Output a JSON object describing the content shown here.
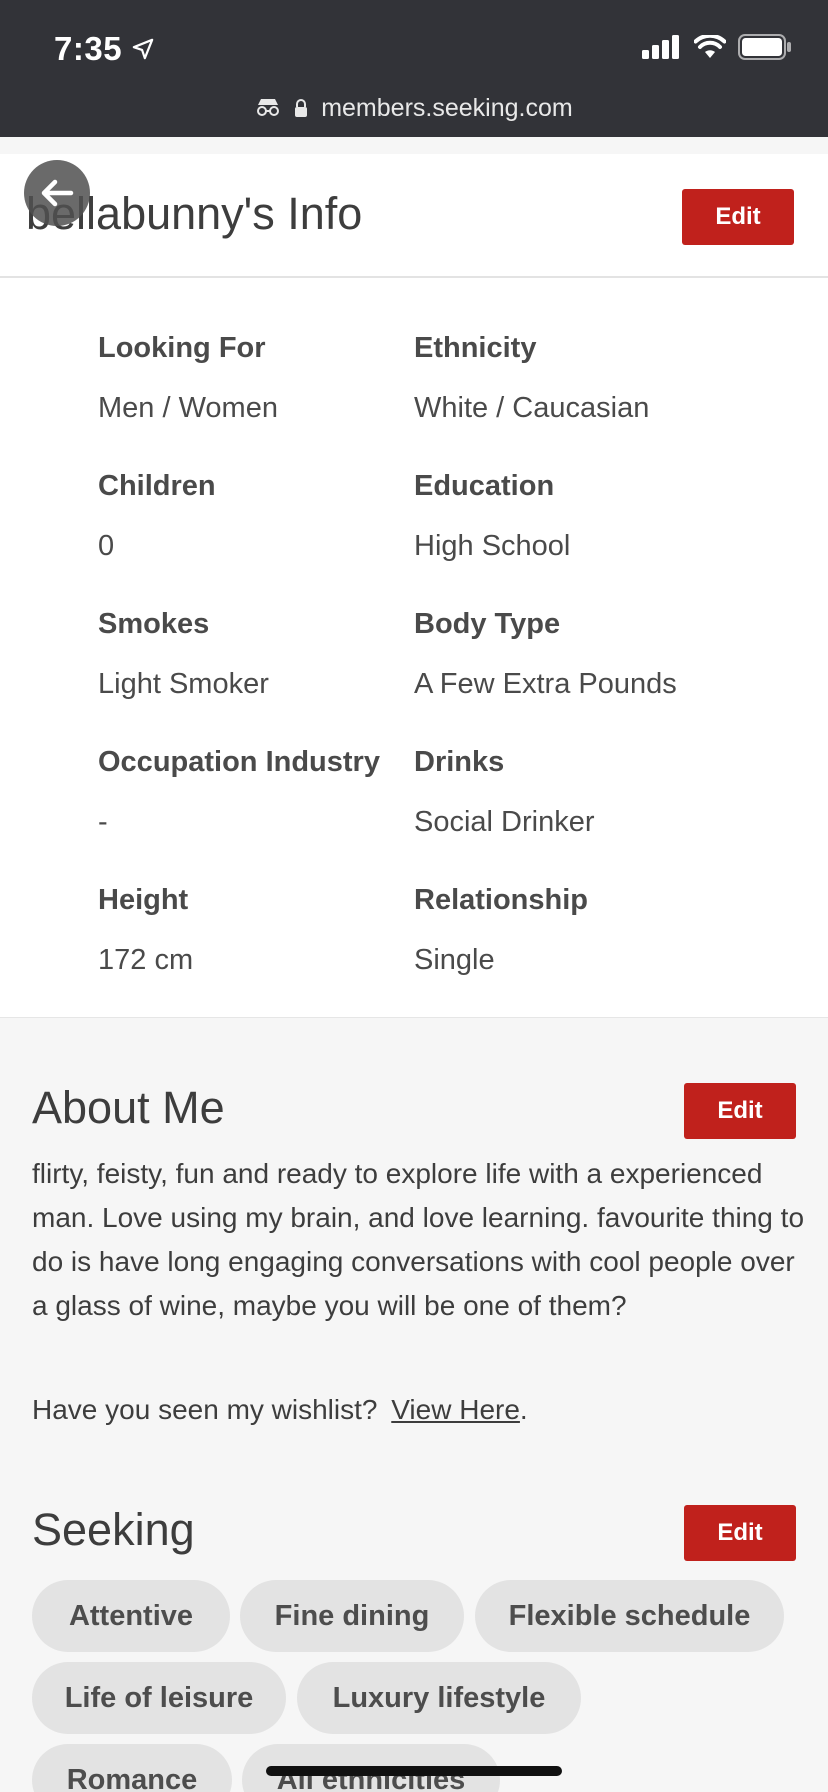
{
  "status_bar": {
    "time": "7:35"
  },
  "browser": {
    "url": "members.seeking.com"
  },
  "info_card": {
    "title": "bellabunny's Info",
    "edit_label": "Edit",
    "fields": [
      {
        "label": "Looking For",
        "value": "Men / Women"
      },
      {
        "label": "Ethnicity",
        "value": "White / Caucasian"
      },
      {
        "label": "Children",
        "value": "0"
      },
      {
        "label": "Education",
        "value": "High School"
      },
      {
        "label": "Smokes",
        "value": "Light Smoker"
      },
      {
        "label": "Body Type",
        "value": "A Few Extra Pounds"
      },
      {
        "label": "Occupation Industry",
        "value": "-"
      },
      {
        "label": "Drinks",
        "value": "Social Drinker"
      },
      {
        "label": "Height",
        "value": "172 cm"
      },
      {
        "label": "Relationship",
        "value": "Single"
      }
    ]
  },
  "about": {
    "title": "About Me",
    "edit_label": "Edit",
    "text": "flirty, feisty, fun and ready to explore life with a experienced man. Love using my brain, and love learning. favourite thing to do is have long engaging conversations with cool people over a glass of wine, maybe you will be one of them?",
    "wishlist_text": "Have you seen my wishlist?",
    "wishlist_link": "View Here",
    "wishlist_period": "."
  },
  "seeking": {
    "title": "Seeking",
    "edit_label": "Edit",
    "tags": [
      "Attentive",
      "Fine dining",
      "Flexible schedule",
      "Life of leisure",
      "Luxury lifestyle",
      "Romance",
      "All ethnicities"
    ]
  },
  "colors": {
    "accent": "#c0211c",
    "status_bar": "#323338",
    "chip_bg": "#e3e3e3"
  }
}
